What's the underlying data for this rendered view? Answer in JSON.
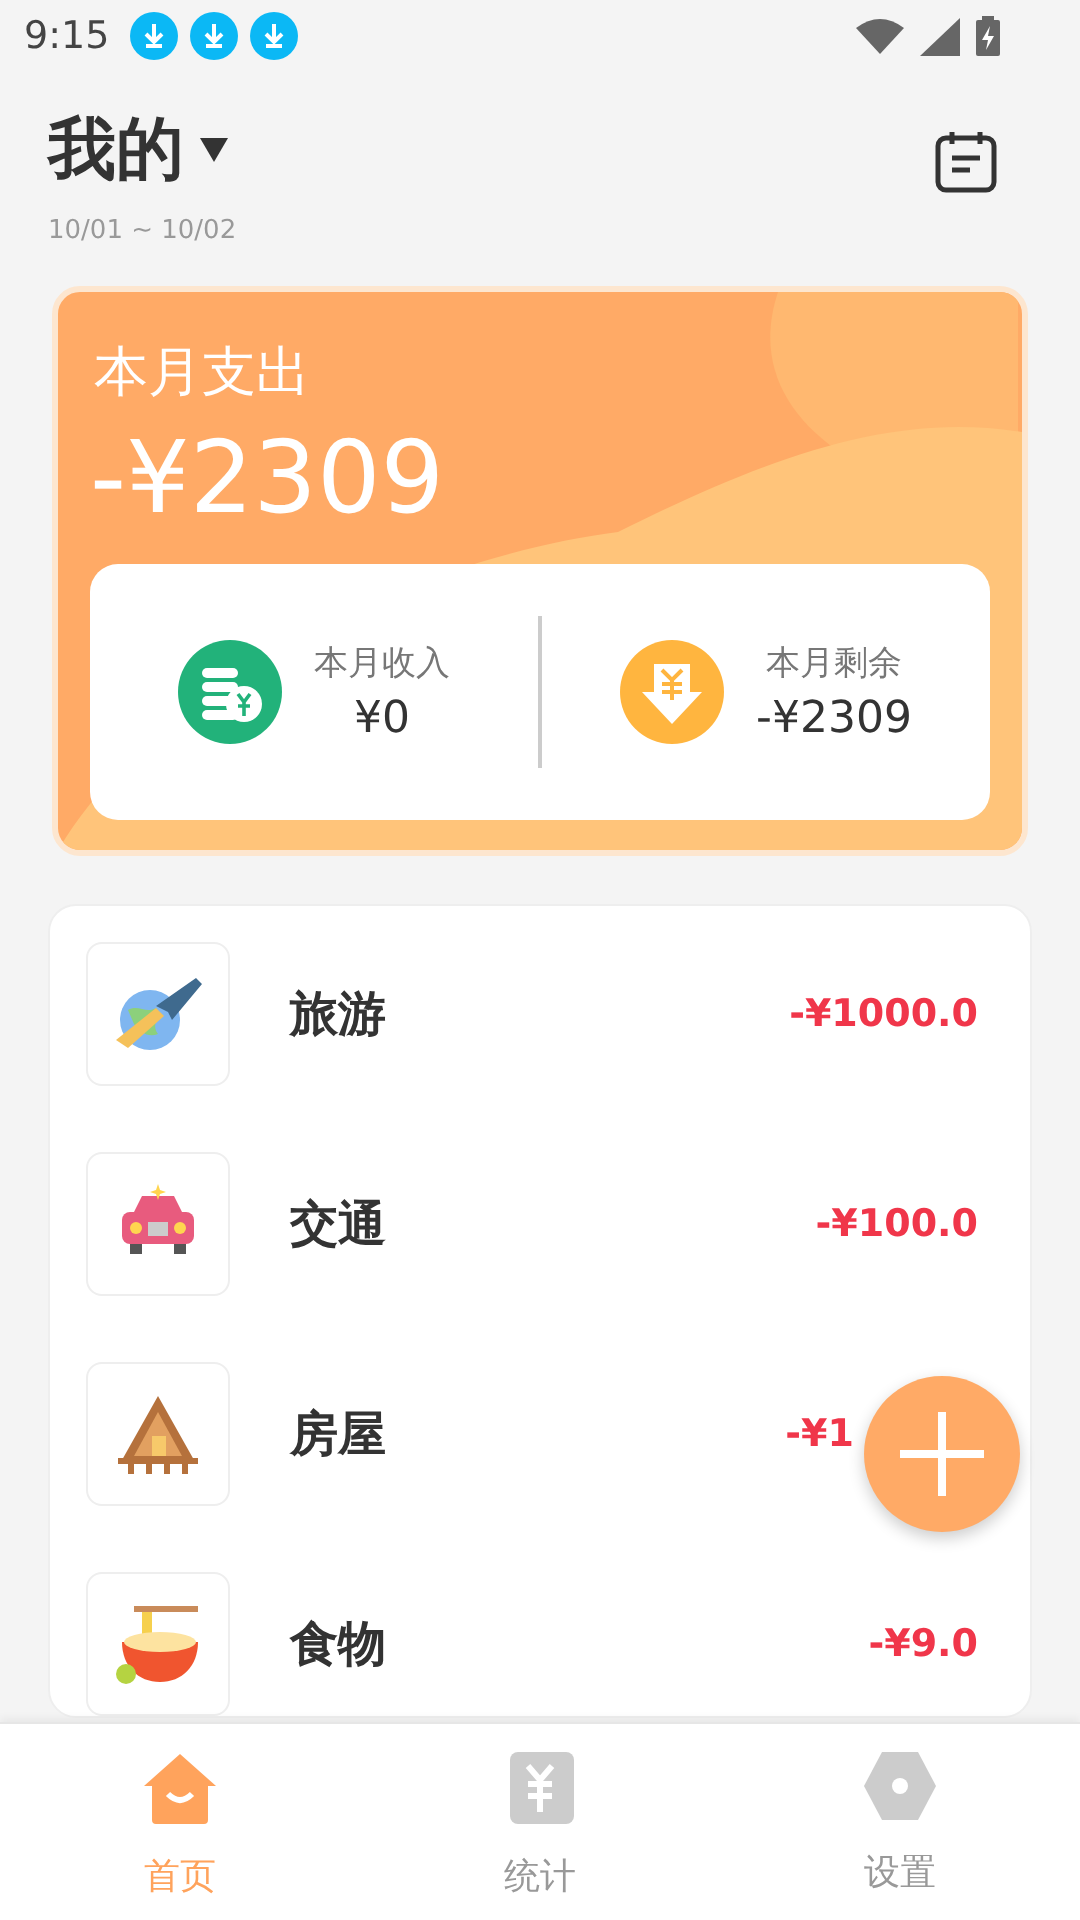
{
  "status_bar": {
    "time": "9:15",
    "notifications": [
      {
        "kind": "download"
      },
      {
        "kind": "download"
      },
      {
        "kind": "download"
      }
    ]
  },
  "header": {
    "title": "我的",
    "date_range": "10/01 ~ 10/02"
  },
  "summary": {
    "label": "本月支出",
    "amount": "-¥2309",
    "stats": [
      {
        "kind": "income",
        "label": "本月收入",
        "value": "¥0"
      },
      {
        "kind": "balance",
        "label": "本月剩余",
        "value": "-¥2309"
      }
    ]
  },
  "categories": [
    {
      "kind": "travel",
      "name": "旅游",
      "amount": "-¥1000.0"
    },
    {
      "kind": "car",
      "name": "交通",
      "amount": "-¥100.0"
    },
    {
      "kind": "house",
      "name": "房屋",
      "amount": "-¥1",
      "covered": true
    },
    {
      "kind": "food",
      "name": "食物",
      "amount": "-¥9.0"
    }
  ],
  "tabs": [
    {
      "kind": "home",
      "label": "首页",
      "selected": true
    },
    {
      "kind": "stats",
      "label": "统计",
      "selected": false
    },
    {
      "kind": "settings",
      "label": "设置",
      "selected": false
    }
  ]
}
